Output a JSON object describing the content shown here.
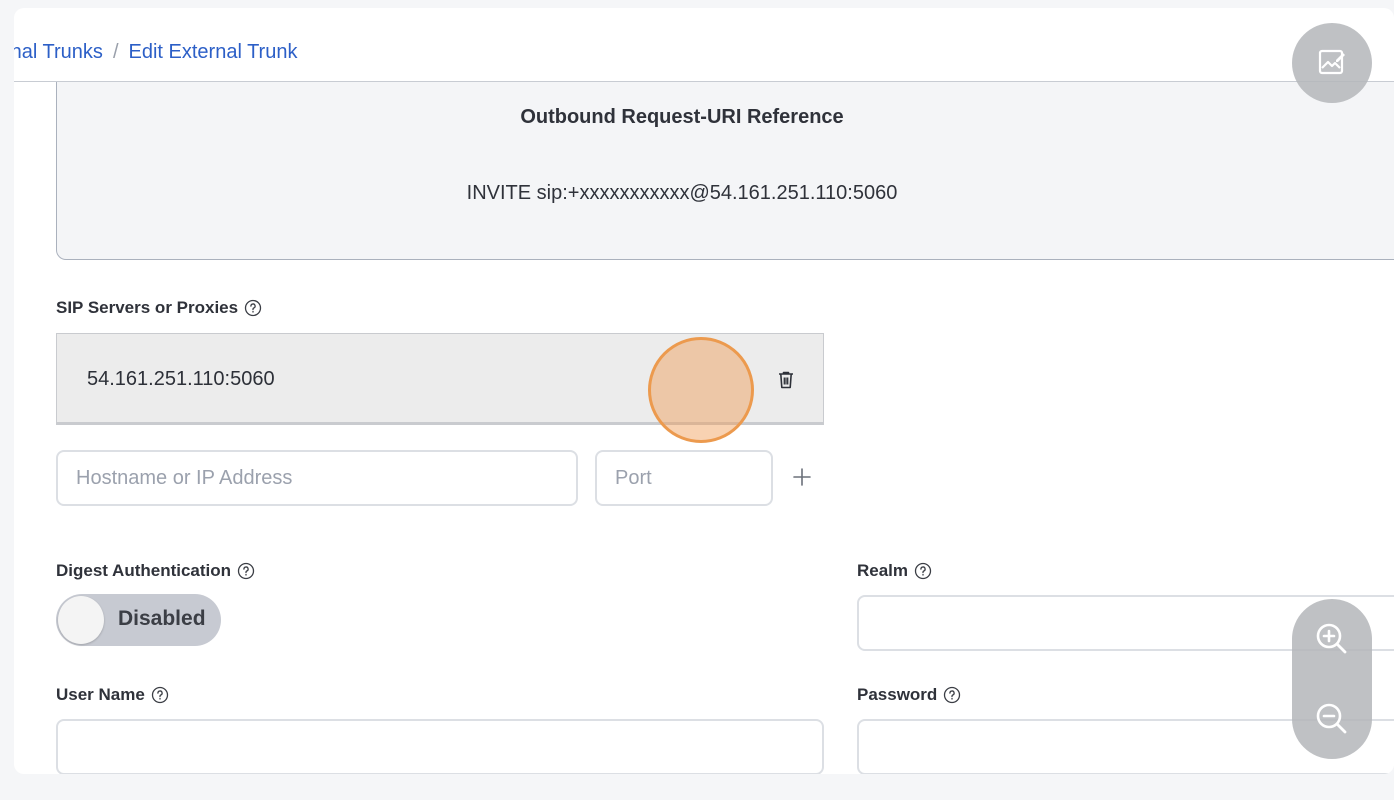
{
  "breadcrumb": {
    "items": [
      {
        "label": "rnal Trunks"
      },
      {
        "label": "Edit External Trunk"
      }
    ],
    "separator": "/"
  },
  "reference": {
    "title": "Outbound Request-URI Reference",
    "value": "INVITE sip:+xxxxxxxxxxx@54.161.251.110:5060"
  },
  "sip_servers": {
    "label": "SIP Servers or Proxies",
    "entries": [
      {
        "address": "54.161.251.110:5060"
      }
    ],
    "host_placeholder": "Hostname or IP Address",
    "port_placeholder": "Port"
  },
  "digest_auth": {
    "label": "Digest Authentication",
    "state": "Disabled"
  },
  "realm": {
    "label": "Realm",
    "value": ""
  },
  "username": {
    "label": "User Name",
    "value": ""
  },
  "password": {
    "label": "Password",
    "value": ""
  },
  "colors": {
    "link": "#2c5fc7",
    "cursor_highlight": "#ec9a4e",
    "toggle_off": "#c7cad2"
  },
  "icons": [
    "help-circle-icon",
    "trash-icon",
    "plus-icon",
    "image-edit-icon",
    "zoom-in-icon",
    "zoom-out-icon"
  ]
}
